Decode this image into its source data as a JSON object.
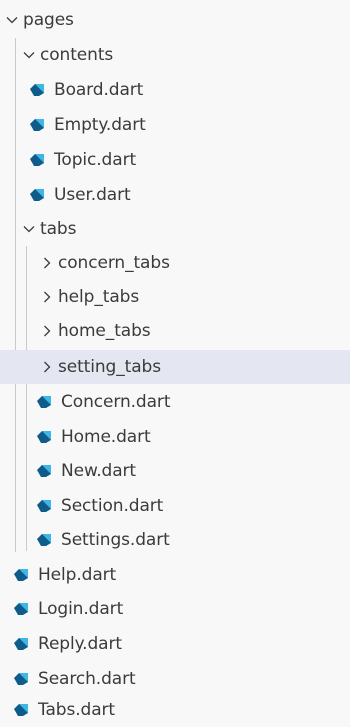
{
  "explorer": {
    "root": {
      "label": "pages",
      "expanded": true,
      "folders": [
        {
          "label": "contents",
          "expanded": true,
          "files": [
            "Board.dart",
            "Empty.dart",
            "Topic.dart",
            "User.dart"
          ]
        },
        {
          "label": "tabs",
          "expanded": true,
          "subfolders": [
            "concern_tabs",
            "help_tabs",
            "home_tabs",
            "setting_tabs"
          ],
          "files": [
            "Concern.dart",
            "Home.dart",
            "New.dart",
            "Section.dart",
            "Settings.dart"
          ]
        }
      ],
      "files": [
        "Help.dart",
        "Login.dart",
        "Reply.dart",
        "Search.dart",
        "Tabs.dart"
      ]
    },
    "selected_item": "setting_tabs",
    "colors": {
      "background": "#f8f8f8",
      "selected_row": "#e4e6f1",
      "text": "#3b3b3b",
      "dart_icon_dark": "#0f5c8a",
      "dart_icon_light": "#3fb7e6",
      "indent_guide": "#c9c9c9"
    },
    "icons": {
      "expanded": "chevron-down-icon",
      "collapsed": "chevron-right-icon",
      "file": "dart-file-icon"
    }
  }
}
